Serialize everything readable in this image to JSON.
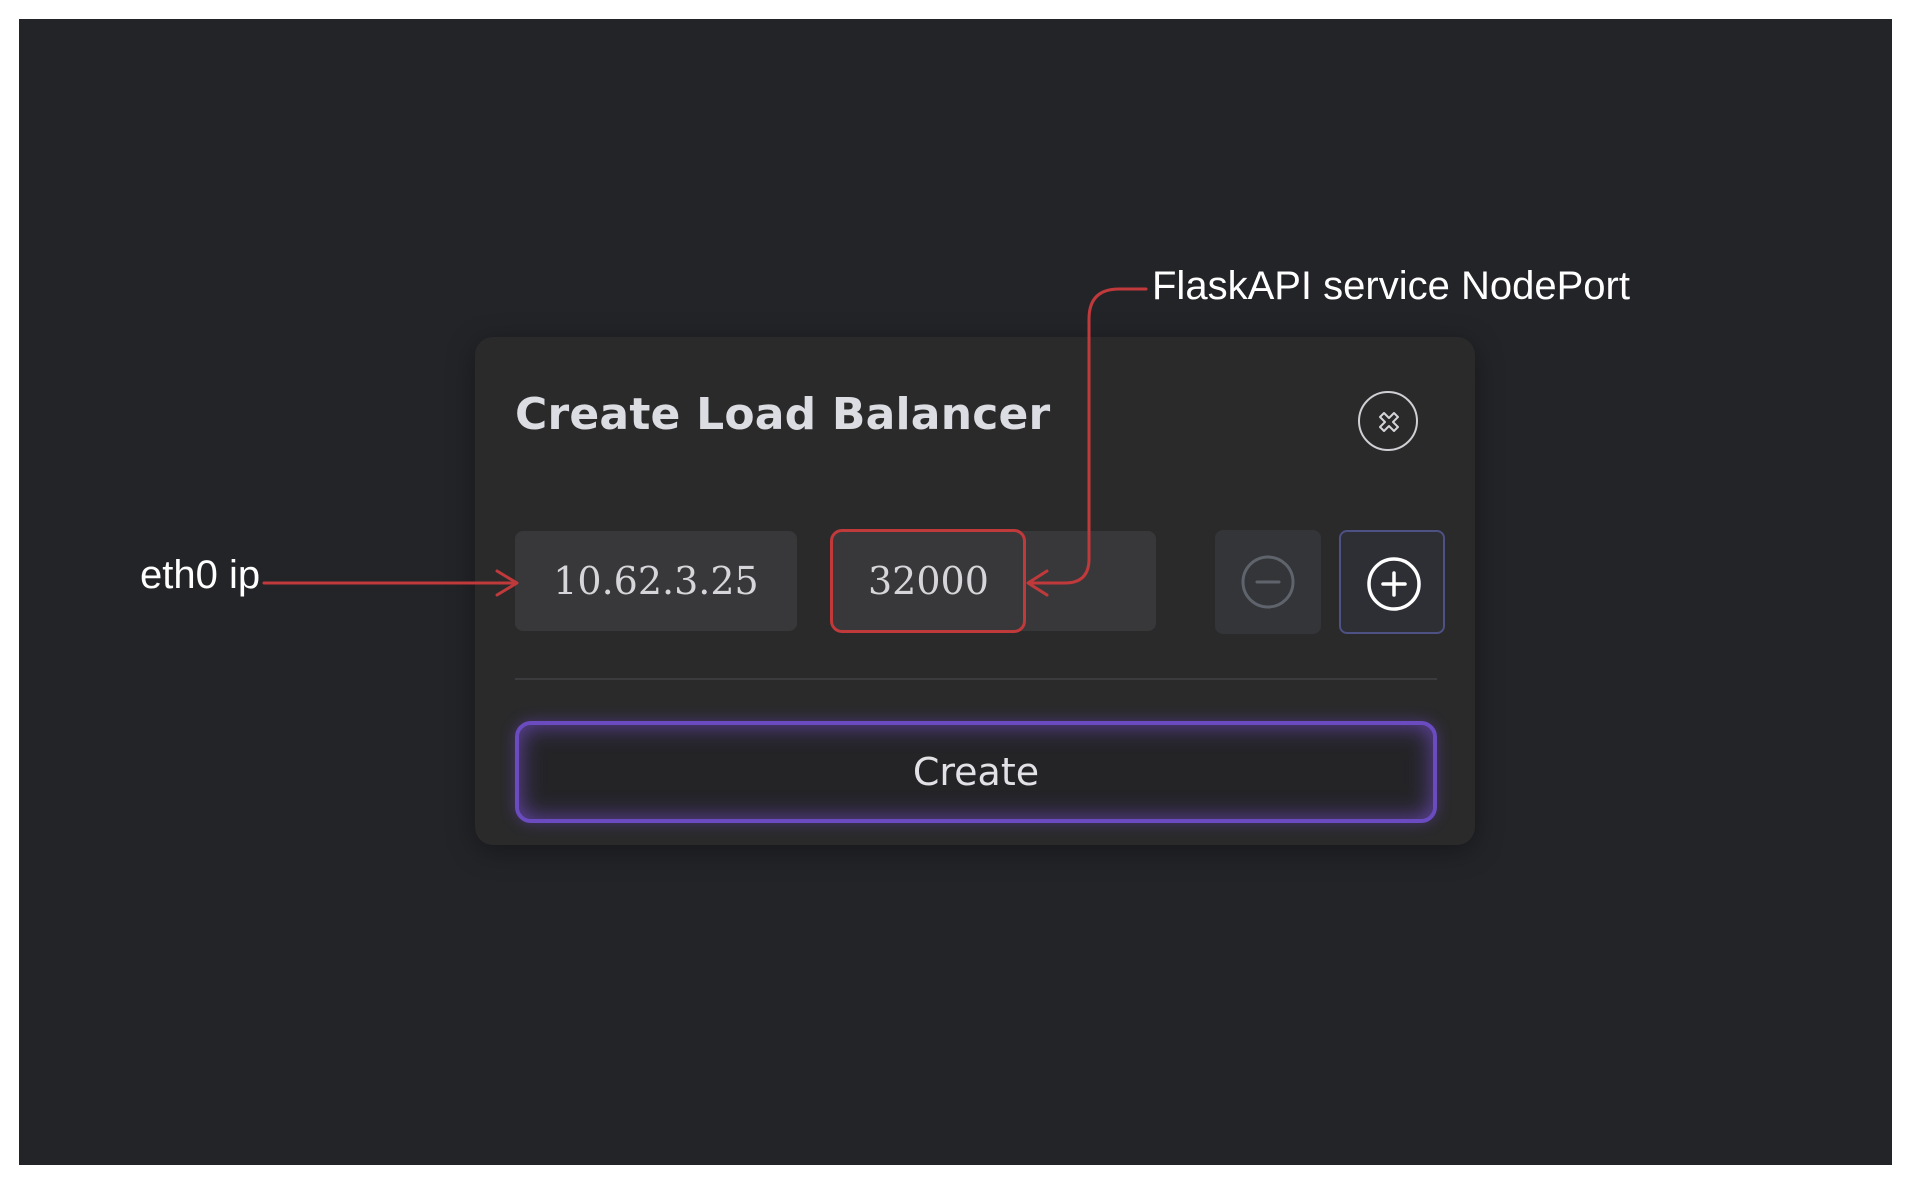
{
  "modal": {
    "title": "Create Load Balancer",
    "ip_value": "10.62.3.25",
    "port_value": "32000",
    "create_label": "Create"
  },
  "icons": {
    "close": "close-circle-icon",
    "remove": "minus-circle-icon",
    "add": "plus-circle-icon"
  },
  "annotations": {
    "ip_label": "eth0 ip",
    "port_label": "FlaskAPI service NodePort"
  },
  "colors": {
    "background": "#232428",
    "modal": "#2a2a2b",
    "annotation": "#c0393b",
    "create_glow": "#6b4cc0"
  }
}
